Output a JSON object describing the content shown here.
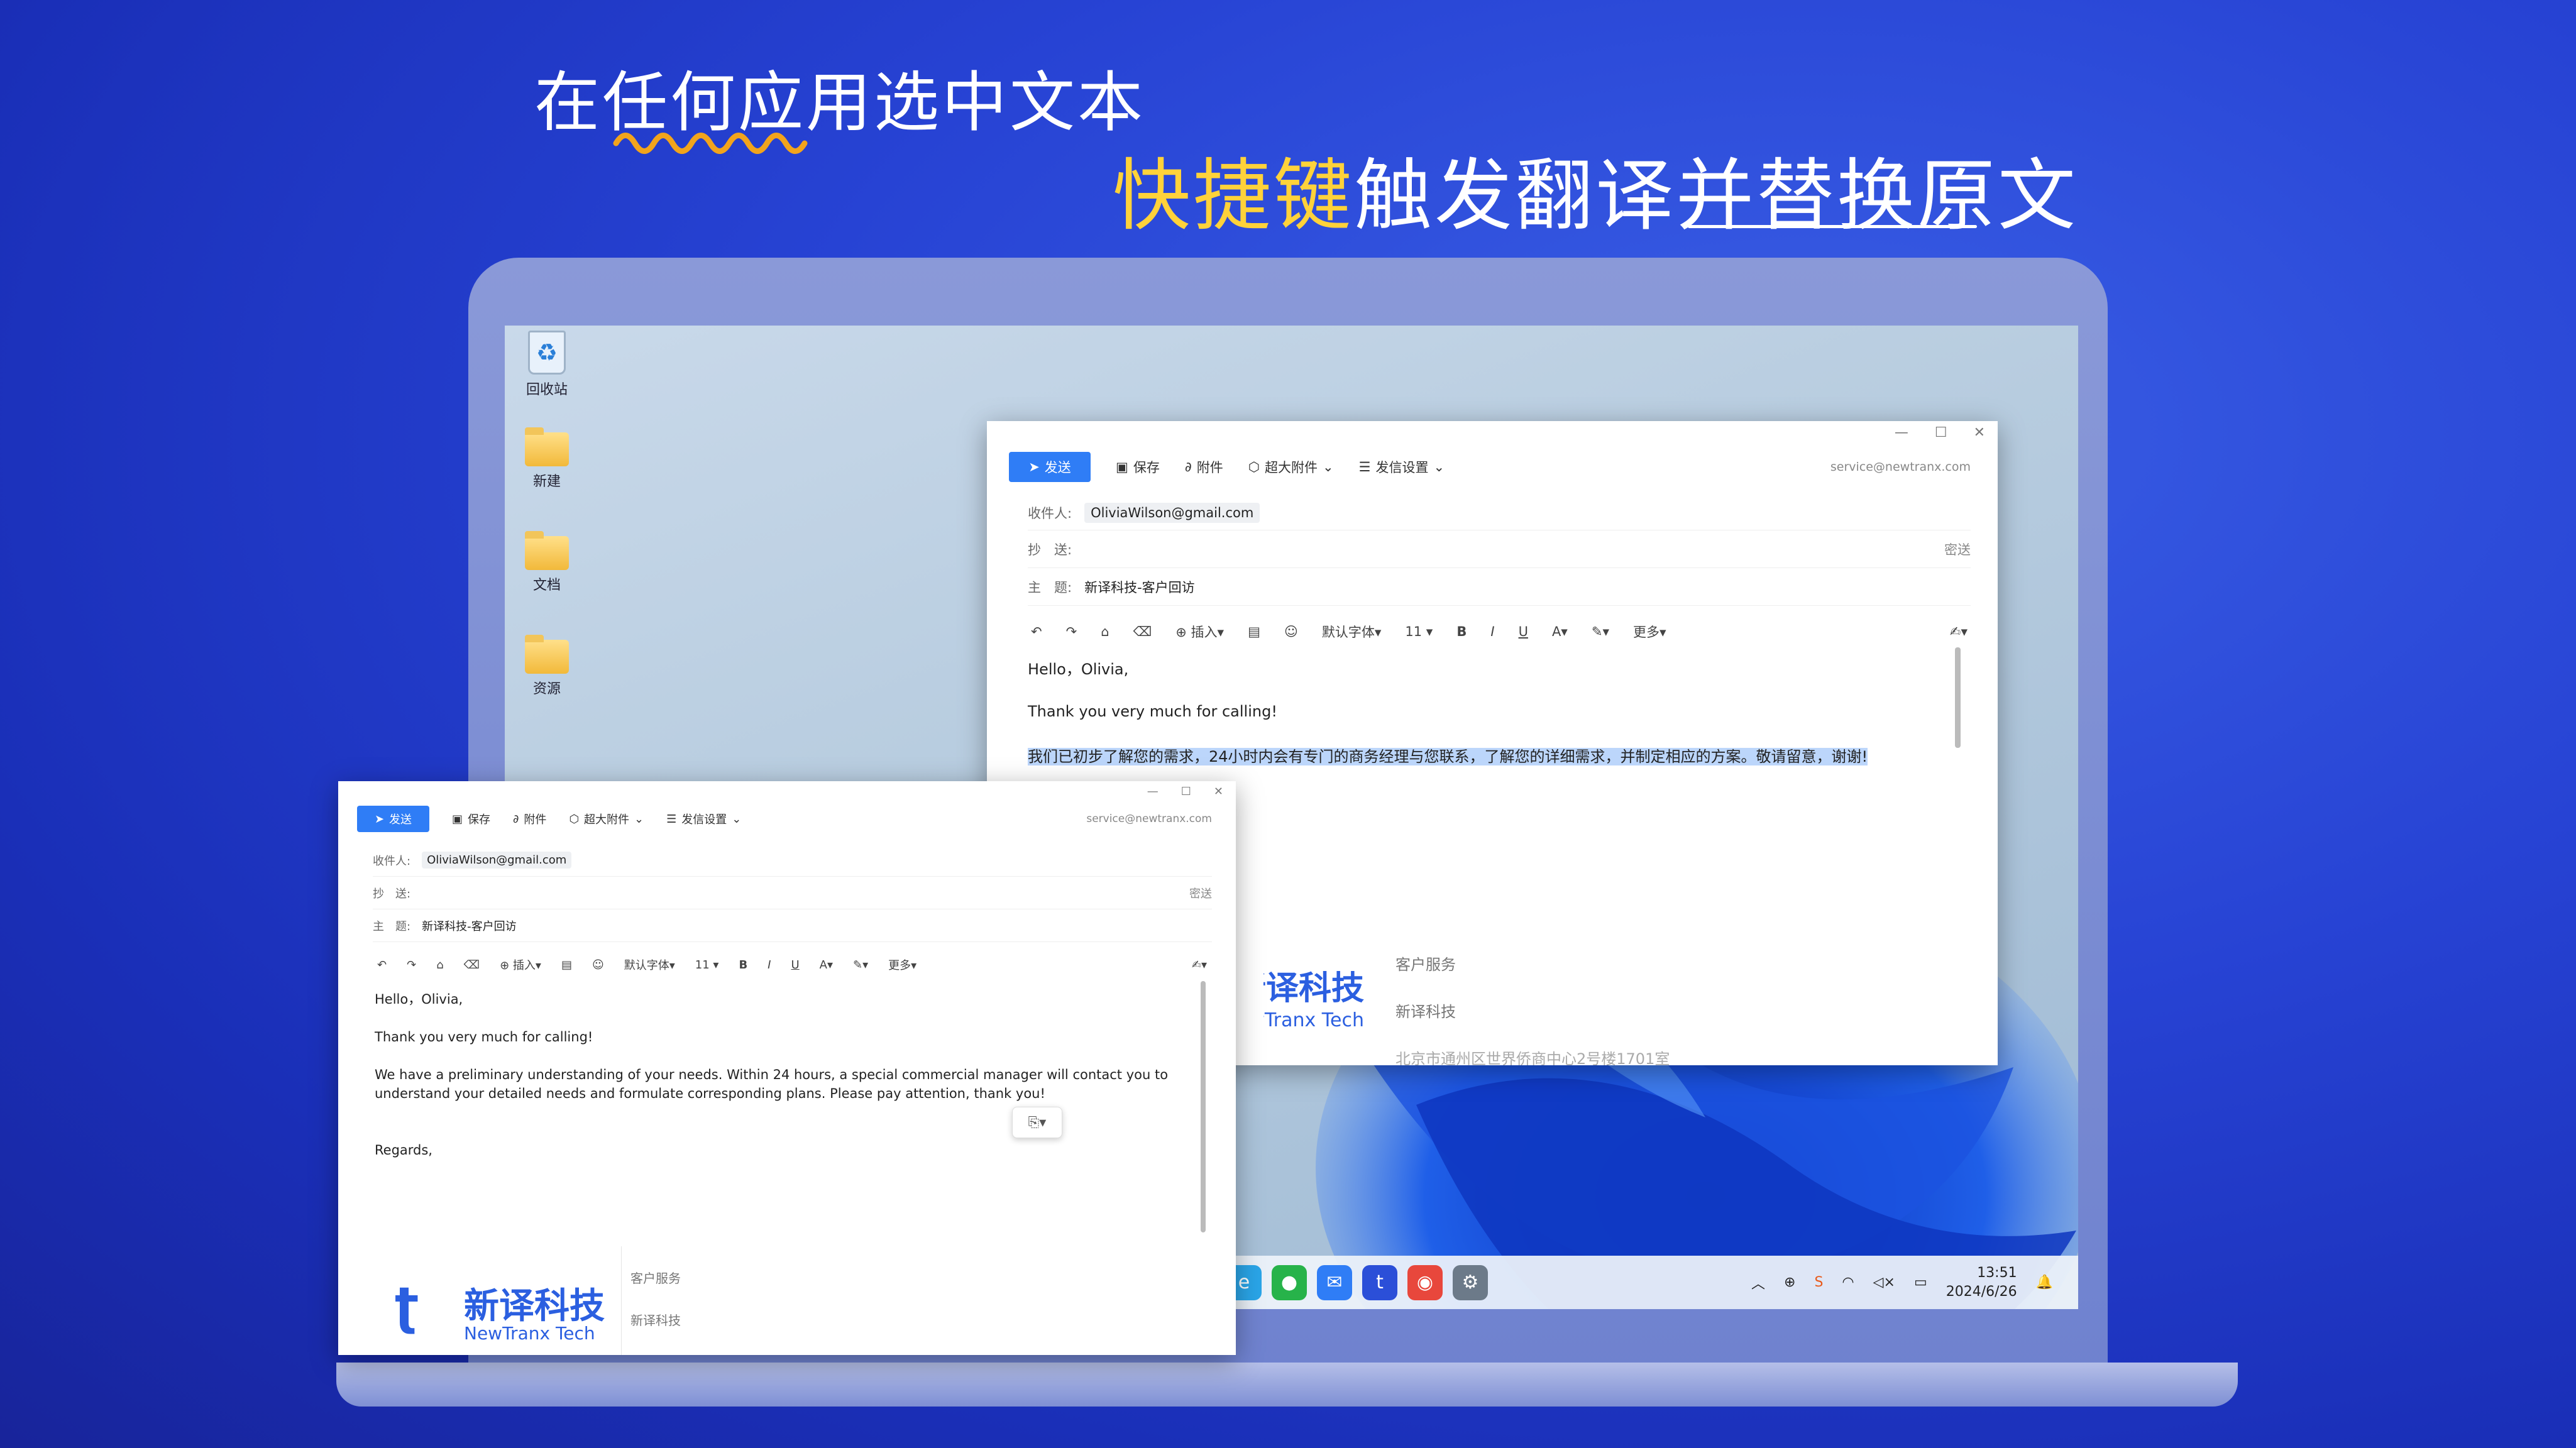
{
  "headline": {
    "line1": "在任何应用选中文本",
    "line2_accent": "快捷键",
    "line2_rest": "触发翻译并替换原文"
  },
  "desktop": {
    "icons": [
      "回收站",
      "新建",
      "文档",
      "资源"
    ]
  },
  "taskbar": {
    "time": "13:51",
    "date": "2024/6/26"
  },
  "mail": {
    "toolbar": {
      "send": "发送",
      "save": "保存",
      "attach": "附件",
      "large_attach": "超大附件",
      "send_settings": "发信设置",
      "sender": "service@newtranx.com"
    },
    "to_label": "收件人:",
    "to_value": "OliviaWilson@gmail.com",
    "cc_label": "抄　送:",
    "bcc": "密送",
    "subject_label": "主　题:",
    "subject_value": "新译科技-客户回访",
    "format": {
      "insert": "插入",
      "font": "默认字体",
      "size": "11",
      "bold": "B",
      "italic": "I",
      "underline": "U",
      "more": "更多"
    },
    "greeting": "Hello，Olivia,",
    "thanks": "Thank you very much for calling!",
    "original_cn": "我们已初步了解您的需求，24小时内会有专门的商务经理与您联系，了解您的详细需求，并制定相应的方案。敬请留意，谢谢!",
    "translated_en_1": "We have a preliminary understanding of your needs. Within 24 hours, a special commercial manager will contact you to",
    "translated_en_2": "understand your detailed needs and formulate corresponding plans. Please pay attention, thank you!",
    "regards": "Regards,",
    "signature": {
      "logo_cn": "新译科技",
      "logo_en": "NewTranx Tech",
      "dept": "客户服务",
      "company": "新译科技",
      "address": "北京市通州区世界侨商中心2号楼1701室"
    }
  }
}
